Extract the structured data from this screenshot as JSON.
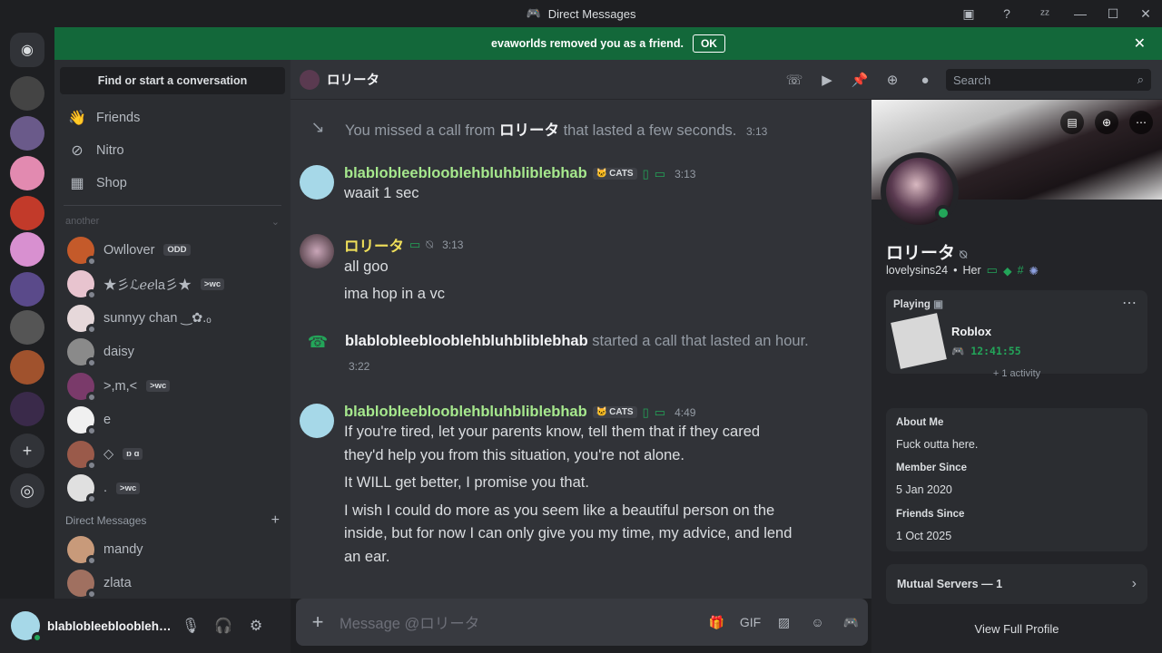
{
  "window": {
    "title": "Direct Messages"
  },
  "banner": {
    "text": "evaworlds removed you as a friend.",
    "ok_label": "OK"
  },
  "dm_column": {
    "find_label": "Find or start a conversation",
    "nav": [
      {
        "label": "Friends",
        "icon": "friends-icon"
      },
      {
        "label": "Nitro",
        "icon": "nitro-icon"
      },
      {
        "label": "Shop",
        "icon": "shop-icon"
      }
    ],
    "section_label": "another",
    "dms": [
      {
        "name": "Owllover",
        "tag": "ODD",
        "avatar_color": "#c45a2a"
      },
      {
        "name": "★彡ℒℯℯla彡★",
        "tag": ">wc",
        "avatar_color": "#e8c4cf"
      },
      {
        "name": "sunnyy chan ‿✿.ₒ",
        "tag": "",
        "avatar_color": "#e6d8da"
      },
      {
        "name": "daisy",
        "tag": "",
        "avatar_color": "#8a8a8a"
      },
      {
        "name": ">,m,<",
        "tag": ">wc",
        "avatar_color": "#7a3a6a"
      },
      {
        "name": "e",
        "tag": "",
        "avatar_color": "#f0f0f0"
      },
      {
        "name": "◇",
        "tag": "ɒ ɑ",
        "avatar_color": "#9a5a4a"
      },
      {
        "name": ".",
        "tag": ">wc",
        "avatar_color": "#e0e0e0"
      }
    ],
    "dm_header": "Direct Messages",
    "direct": [
      {
        "name": "mandy",
        "avatar_color": "#c89a7a"
      },
      {
        "name": "zlata",
        "avatar_color": "#a07060"
      }
    ]
  },
  "user": {
    "name": "blablobleeblooblehbluhbliblebhab"
  },
  "chat": {
    "channel_name": "ロリータ",
    "search_placeholder": "Search",
    "missed_call": {
      "prefix": "You missed a call from",
      "name": "ロリータ",
      "suffix": "that lasted a few seconds.",
      "time": "3:13"
    },
    "msg1": {
      "author": "blablobleeblooblehbluhbliblebhab",
      "tag": "CATS",
      "time": "3:13",
      "lines": [
        "waait 1 sec"
      ]
    },
    "msg2": {
      "author": "ロリータ",
      "time": "3:13",
      "lines": [
        "all goo",
        "ima hop in a vc"
      ]
    },
    "call": {
      "name": "blablobleeblooblehbluhbliblebhab",
      "suffix": "started a call that lasted an hour.",
      "time": "3:22"
    },
    "msg3": {
      "author": "blablobleeblooblehbluhbliblebhab",
      "tag": "CATS",
      "time": "4:49",
      "lines": [
        "If you're tired, let your parents know, tell them that if they cared",
        "they'd help you from this situation, you're not alone.",
        "It WILL get better, I promise you that.",
        "I wish I could do more as you seem like a beautiful person on the",
        "inside, but for now I can only give you my time, my advice, and lend",
        "an ear."
      ]
    },
    "input_placeholder": "Message @ロリータ",
    "colors": {
      "author_green": "#a6e88d",
      "author_yellow": "#f0e05a"
    }
  },
  "profile": {
    "display_name": "ロリータ",
    "username": "lovelysins24",
    "pronouns": "Her",
    "playing_label": "Playing",
    "game": "Roblox",
    "game_time": "12:41:55",
    "activity_more": "+ 1 activity",
    "about_label": "About Me",
    "about_text": "Fuck outta here.",
    "member_since_label": "Member Since",
    "member_since": "5 Jan 2020",
    "friends_since_label": "Friends Since",
    "friends_since": "1 Oct 2025",
    "mutual_servers": "Mutual Servers — 1",
    "view_full": "View Full Profile"
  }
}
